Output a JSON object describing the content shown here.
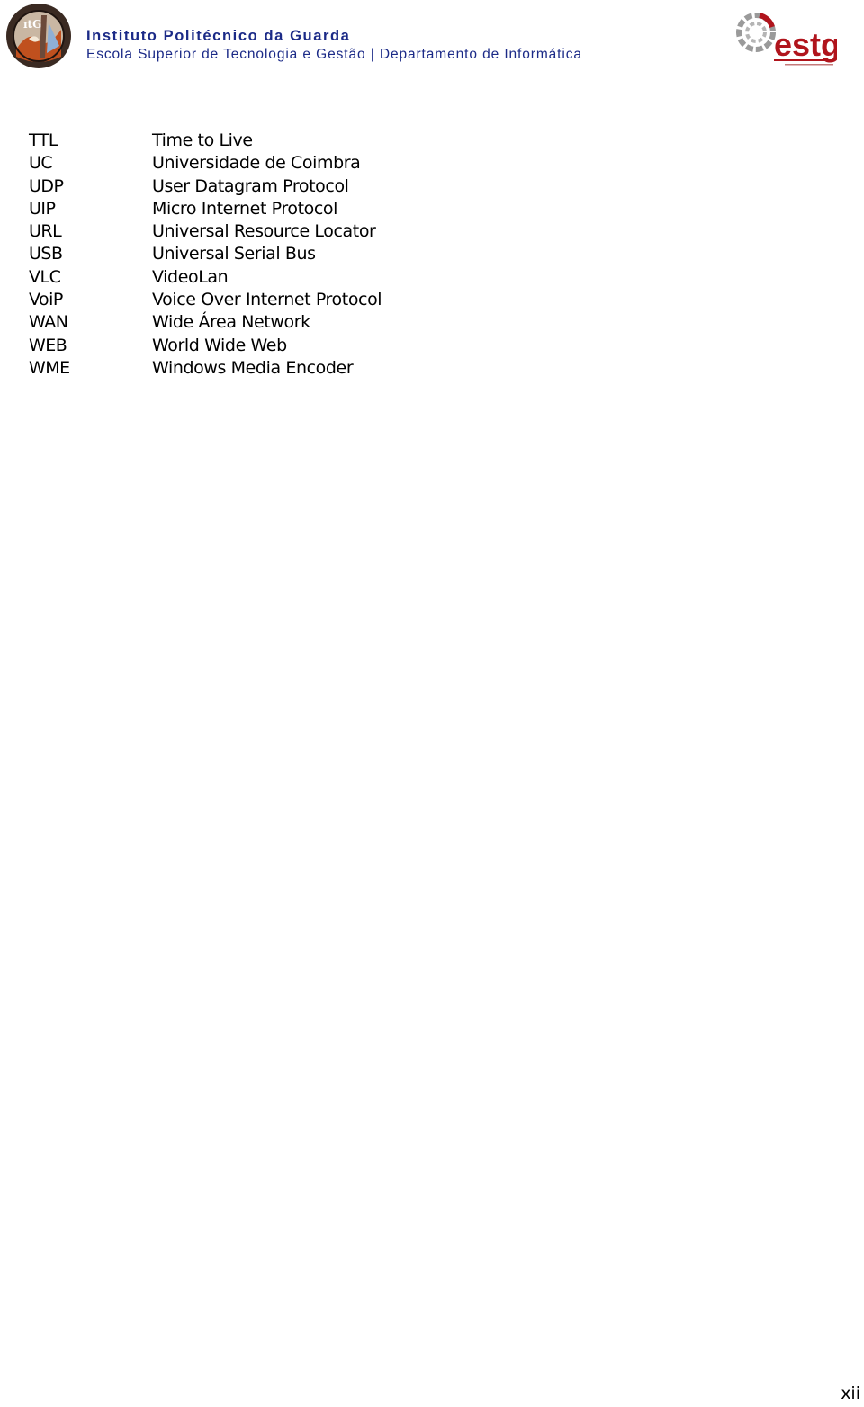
{
  "header": {
    "institution": "Instituto Politécnico da Guarda",
    "subtitle": "Escola Superior de Tecnologia e Gestão | Departamento de Informática",
    "left_logo_icon": "ipg-seal-logo",
    "right_logo_icon": "estg-logo",
    "right_logo_text": "estg",
    "brand_color": "#1b2a87",
    "estg_red": "#b0141c"
  },
  "abbreviations": [
    {
      "code": "TTL",
      "meaning": "Time to Live"
    },
    {
      "code": "UC",
      "meaning": "Universidade de Coimbra"
    },
    {
      "code": "UDP",
      "meaning": "User Datagram Protocol"
    },
    {
      "code": "UIP",
      "meaning": "Micro Internet Protocol"
    },
    {
      "code": "URL",
      "meaning": "Universal Resource Locator"
    },
    {
      "code": "USB",
      "meaning": "Universal Serial Bus"
    },
    {
      "code": "VLC",
      "meaning": "VideoLan"
    },
    {
      "code": "VoiP",
      "meaning": "Voice Over Internet Protocol"
    },
    {
      "code": "WAN",
      "meaning": "Wide Área Network"
    },
    {
      "code": "WEB",
      "meaning": "World Wide Web"
    },
    {
      "code": "WME",
      "meaning": "Windows Media Encoder"
    }
  ],
  "footer": {
    "page_number": "xii"
  }
}
